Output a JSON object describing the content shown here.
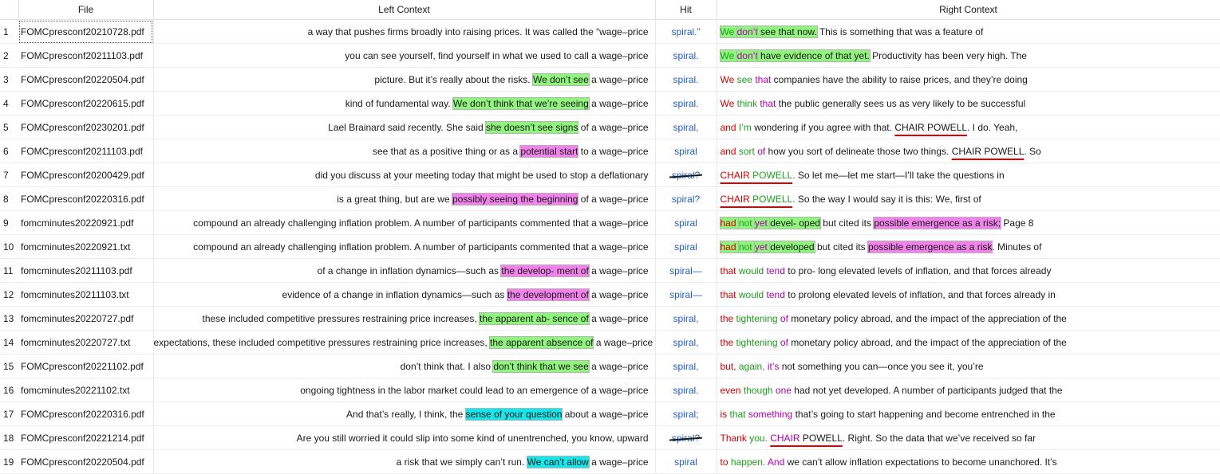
{
  "columns": [
    "",
    "File",
    "Left Context",
    "Hit",
    "Right Context"
  ],
  "rows": [
    {
      "num": "1",
      "file": "FOMCpresconf20210728.pdf",
      "selected": true,
      "left": [
        {
          "t": "a way that pushes firms broadly into raising prices. It was called the “wage–price"
        }
      ],
      "hit": "spiral.”",
      "hit_strike": false,
      "right": [
        {
          "t": "We ",
          "c": "grn",
          "h": "g"
        },
        {
          "t": "don’t",
          "c": "mag",
          "h": "g"
        },
        {
          "t": " see that now.",
          "h": "g"
        },
        {
          "t": " This is something that was a feature of"
        }
      ]
    },
    {
      "num": "2",
      "file": "FOMCpresconf20211103.pdf",
      "left": [
        {
          "t": "you can see yourself, find yourself in what we used to call a wage–price"
        }
      ],
      "hit": "spiral.",
      "right": [
        {
          "t": "We ",
          "c": "grn",
          "h": "g"
        },
        {
          "t": "don’t",
          "c": "mag",
          "h": "g"
        },
        {
          "t": " have evidence of that yet.",
          "h": "g"
        },
        {
          "t": " Productivity has been very high. The"
        }
      ]
    },
    {
      "num": "3",
      "file": "FOMCpresconf20220504.pdf",
      "left": [
        {
          "t": "picture. But it’s really about the risks. "
        },
        {
          "t": "We don’t see",
          "h": "g"
        },
        {
          "t": " a wage–price"
        }
      ],
      "hit": "spiral.",
      "right": [
        {
          "t": "We ",
          "c": "red"
        },
        {
          "t": "see ",
          "c": "grn"
        },
        {
          "t": "that ",
          "c": "mag"
        },
        {
          "t": "companies have the ability to raise prices, and they’re doing"
        }
      ]
    },
    {
      "num": "4",
      "file": "FOMCpresconf20220615.pdf",
      "left": [
        {
          "t": "kind of fundamental way. "
        },
        {
          "t": "We don’t think that we’re seeing",
          "h": "g"
        },
        {
          "t": " a wage–price"
        }
      ],
      "hit": "spiral.",
      "right": [
        {
          "t": "We ",
          "c": "red"
        },
        {
          "t": "think ",
          "c": "grn"
        },
        {
          "t": "that ",
          "c": "mag"
        },
        {
          "t": "the public generally sees us as very likely to be successful"
        }
      ]
    },
    {
      "num": "5",
      "file": "FOMCpresconf20230201.pdf",
      "left": [
        {
          "t": "Lael Brainard said recently. She said "
        },
        {
          "t": "she doesn’t see signs",
          "h": "g"
        },
        {
          "t": " of a wage–price"
        }
      ],
      "hit": "spiral,",
      "right": [
        {
          "t": "and ",
          "c": "red"
        },
        {
          "t": "I’m ",
          "c": "grn"
        },
        {
          "t": "wondering if you agree with that. "
        },
        {
          "t": "CHAIR POWELL",
          "u": true
        },
        {
          "t": ". I do. Yeah,"
        }
      ]
    },
    {
      "num": "6",
      "file": "FOMCpresconf20211103.pdf",
      "left": [
        {
          "t": "see that as a positive thing or as a "
        },
        {
          "t": "potential start",
          "h": "m"
        },
        {
          "t": " to a wage–price"
        }
      ],
      "hit": "spiral",
      "right": [
        {
          "t": "and ",
          "c": "red"
        },
        {
          "t": "sort ",
          "c": "grn"
        },
        {
          "t": "of ",
          "c": "mag"
        },
        {
          "t": "how you sort of delineate those two things. "
        },
        {
          "t": "CHAIR POWELL",
          "u": true
        },
        {
          "t": ". So"
        }
      ]
    },
    {
      "num": "7",
      "file": "FOMCpresconf20200429.pdf",
      "left": [
        {
          "t": "did you discuss at your meeting today that might be used to stop a deflationary"
        }
      ],
      "hit": "spiral?",
      "hit_strike": true,
      "right": [
        {
          "t": "CHAIR ",
          "c": "red",
          "u": true
        },
        {
          "t": "POWELL",
          "c": "grn",
          "u": true
        },
        {
          "t": ". ",
          "c": "mag"
        },
        {
          "t": "So let me—let me start—I’ll take the questions in"
        }
      ]
    },
    {
      "num": "8",
      "file": "FOMCpresconf20220316.pdf",
      "left": [
        {
          "t": "is a great thing, but are we "
        },
        {
          "t": "possibly seeing the beginning",
          "h": "m"
        },
        {
          "t": " of a wage–price"
        }
      ],
      "hit": "spiral?",
      "right": [
        {
          "t": "CHAIR ",
          "c": "red",
          "u": true
        },
        {
          "t": "POWELL",
          "c": "grn",
          "u": true
        },
        {
          "t": ". ",
          "c": "mag"
        },
        {
          "t": "So the way I would say it is this: We, first of"
        }
      ]
    },
    {
      "num": "9",
      "file": "fomcminutes20220921.pdf",
      "left": [
        {
          "t": "compound an already challenging inflation problem. A number of participants commented that a wage–price"
        }
      ],
      "hit": "spiral",
      "right": [
        {
          "t": "had ",
          "c": "red",
          "h": "g"
        },
        {
          "t": "not ",
          "c": "grn",
          "h": "g"
        },
        {
          "t": "yet ",
          "c": "mag",
          "h": "g"
        },
        {
          "t": "devel- oped",
          "h": "g"
        },
        {
          "t": " but cited its "
        },
        {
          "t": "possible emergence as a risk;",
          "h": "m"
        },
        {
          "t": " Page 8"
        }
      ]
    },
    {
      "num": "10",
      "file": "fomcminutes20220921.txt",
      "left": [
        {
          "t": "compound an already challenging inflation problem. A number of participants commented that a wage–price"
        }
      ],
      "hit": "spiral",
      "right": [
        {
          "t": "had ",
          "c": "red",
          "h": "g"
        },
        {
          "t": "not ",
          "c": "grn",
          "h": "g"
        },
        {
          "t": "yet ",
          "c": "mag",
          "h": "g"
        },
        {
          "t": "developed",
          "h": "g"
        },
        {
          "t": " but cited its "
        },
        {
          "t": "possible emergence as a risk",
          "h": "m"
        },
        {
          "t": ". Minutes of"
        }
      ]
    },
    {
      "num": "11",
      "file": "fomcminutes20211103.pdf",
      "left": [
        {
          "t": "of a change in inflation dynamics—such as "
        },
        {
          "t": "the develop- ment of",
          "h": "m"
        },
        {
          "t": " a wage–price"
        }
      ],
      "hit": "spiral—",
      "right": [
        {
          "t": "that ",
          "c": "red"
        },
        {
          "t": "would ",
          "c": "grn"
        },
        {
          "t": "tend ",
          "c": "mag"
        },
        {
          "t": "to pro- long elevated levels of inflation, and that forces already"
        }
      ]
    },
    {
      "num": "12",
      "file": "fomcminutes20211103.txt",
      "left": [
        {
          "t": "evidence of a change in inflation dynamics—such as "
        },
        {
          "t": "the development of",
          "h": "m"
        },
        {
          "t": " a wage–price"
        }
      ],
      "hit": "spiral—",
      "right": [
        {
          "t": "that ",
          "c": "red"
        },
        {
          "t": "would ",
          "c": "grn"
        },
        {
          "t": "tend ",
          "c": "mag"
        },
        {
          "t": "to prolong elevated levels of inflation, and that forces already in"
        }
      ]
    },
    {
      "num": "13",
      "file": "fomcminutes20220727.pdf",
      "left": [
        {
          "t": "these included competitive pressures restraining price increases, "
        },
        {
          "t": "the apparent ab- sence of",
          "h": "g"
        },
        {
          "t": " a wage–price"
        }
      ],
      "hit": "spiral,",
      "right": [
        {
          "t": "the ",
          "c": "red"
        },
        {
          "t": "tightening ",
          "c": "grn"
        },
        {
          "t": "of ",
          "c": "mag"
        },
        {
          "t": "monetary policy abroad, and the impact of the appreciation of the"
        }
      ]
    },
    {
      "num": "14",
      "file": "fomcminutes20220727.txt",
      "left": [
        {
          "t": "expectations, these included competitive pressures restraining price increases, "
        },
        {
          "t": "the apparent absence of",
          "h": "g"
        },
        {
          "t": " a wage–price"
        }
      ],
      "hit": "spiral,",
      "right": [
        {
          "t": "the ",
          "c": "red"
        },
        {
          "t": "tightening ",
          "c": "grn"
        },
        {
          "t": "of ",
          "c": "mag"
        },
        {
          "t": "monetary policy abroad, and the impact of the appreciation of the"
        }
      ]
    },
    {
      "num": "15",
      "file": "FOMCpresconf20221102.pdf",
      "left": [
        {
          "t": "don’t think that. I also "
        },
        {
          "t": "don’t think that we see",
          "h": "g"
        },
        {
          "t": " a wage–price"
        }
      ],
      "hit": "spiral,",
      "right": [
        {
          "t": "but, ",
          "c": "red"
        },
        {
          "t": "again, ",
          "c": "grn"
        },
        {
          "t": "it’s ",
          "c": "mag"
        },
        {
          "t": "not something you can—once you see it, you’re"
        }
      ]
    },
    {
      "num": "16",
      "file": "fomcminutes20221102.txt",
      "left": [
        {
          "t": "ongoing tightness in the labor market could lead to an emergence of a wage–price"
        }
      ],
      "hit": "spiral.",
      "right": [
        {
          "t": "even ",
          "c": "red"
        },
        {
          "t": "though ",
          "c": "grn"
        },
        {
          "t": "one ",
          "c": "mag"
        },
        {
          "t": "had not yet developed. A number of participants judged that the"
        }
      ]
    },
    {
      "num": "17",
      "file": "FOMCpresconf20220316.pdf",
      "left": [
        {
          "t": "And that’s really, I think, the "
        },
        {
          "t": "sense of your question",
          "h": "c"
        },
        {
          "t": " about a wage–price"
        }
      ],
      "hit": "spiral;",
      "right": [
        {
          "t": "is ",
          "c": "red"
        },
        {
          "t": "that ",
          "c": "grn"
        },
        {
          "t": "something ",
          "c": "mag"
        },
        {
          "t": "that’s going to start happening and become entrenched in the"
        }
      ]
    },
    {
      "num": "18",
      "file": "FOMCpresconf20221214.pdf",
      "left": [
        {
          "t": "Are you still worried it could slip into some kind of unentrenched, you know, upward"
        }
      ],
      "hit": "spiral?",
      "hit_strike": true,
      "right": [
        {
          "t": "Thank ",
          "c": "red"
        },
        {
          "t": "you. ",
          "c": "grn"
        },
        {
          "t": "CHAIR ",
          "c": "mag",
          "u": true
        },
        {
          "t": "POWELL",
          "u": true
        },
        {
          "t": ". Right. So the data that we’ve received so far"
        }
      ]
    },
    {
      "num": "19",
      "file": "FOMCpresconf20220504.pdf",
      "left": [
        {
          "t": "a risk that we simply can’t run. "
        },
        {
          "t": "We can’t allow",
          "h": "c"
        },
        {
          "t": " a wage–price"
        }
      ],
      "hit": "spiral",
      "right": [
        {
          "t": "to ",
          "c": "red"
        },
        {
          "t": "happen. ",
          "c": "grn"
        },
        {
          "t": "And ",
          "c": "mag"
        },
        {
          "t": "we can’t allow inflation expectations to become unanchored. It’s"
        }
      ]
    }
  ]
}
